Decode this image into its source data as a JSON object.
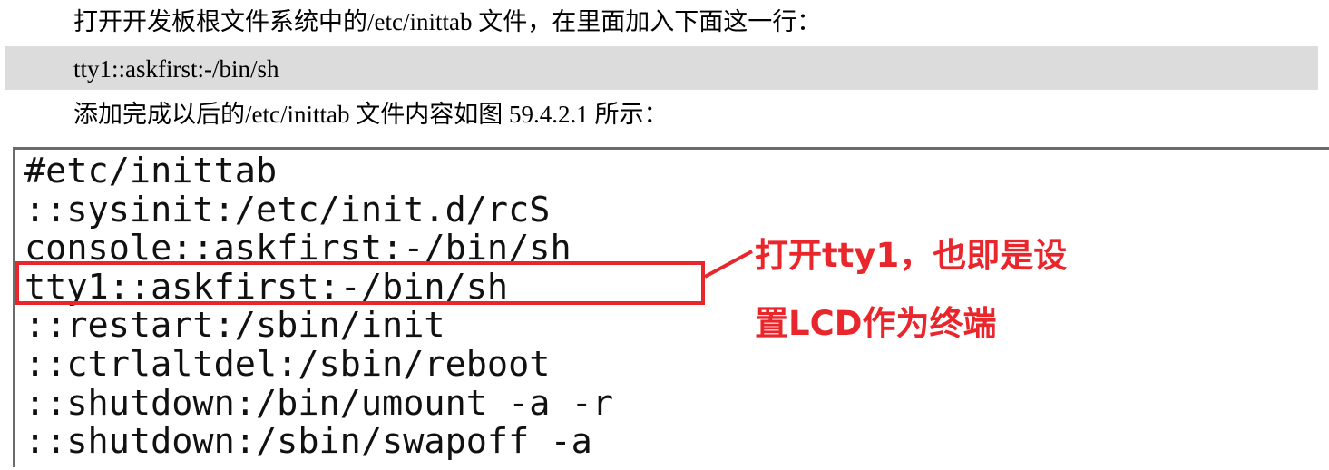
{
  "paragraphs": {
    "intro": "打开开发板根文件系统中的/etc/inittab 文件，在里面加入下面这一行：",
    "code_line": "tty1::askfirst:-/bin/sh",
    "after": "添加完成以后的/etc/inittab 文件内容如图 59.4.2.1 所示："
  },
  "figure": {
    "lines": [
      "#etc/inittab",
      "::sysinit:/etc/init.d/rcS",
      "console::askfirst:-/bin/sh",
      "tty1::askfirst:-/bin/sh",
      "::restart:/sbin/init",
      "::ctrlaltdel:/sbin/reboot",
      "::shutdown:/bin/umount -a -r",
      "::shutdown:/sbin/swapoff -a"
    ],
    "callout_line1": "打开tty1，也即是设",
    "callout_line2": "置LCD作为终端"
  },
  "colors": {
    "highlight": "#e8262b",
    "code_bg": "#dcdcdc"
  }
}
